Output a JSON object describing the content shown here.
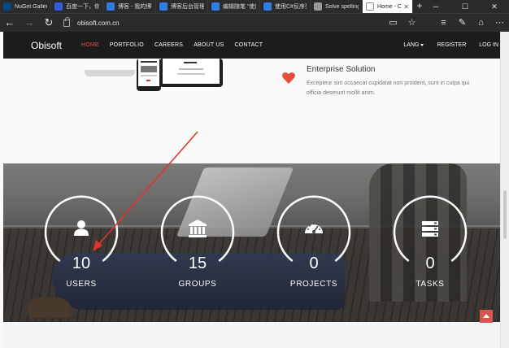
{
  "browser": {
    "tabs": [
      {
        "title": "NuGet Gallery",
        "color": "#004880"
      },
      {
        "title": "百度一下，你就",
        "color": "#2f5ee0"
      },
      {
        "title": "博客 - 我的博客",
        "color": "#2f7de1"
      },
      {
        "title": "博客后台管理",
        "color": "#2f7de1"
      },
      {
        "title": "编辑随笔 \"使用",
        "color": "#2f7de1"
      },
      {
        "title": "使用C#反序列",
        "color": "#2f7de1"
      },
      {
        "title": "Solve spelling",
        "color": "#999999"
      },
      {
        "title": "Home - Ob",
        "color": "#666666",
        "active": true
      }
    ],
    "new_tab": "+",
    "url": "obisoft.com.cn"
  },
  "site": {
    "logo": "Obisoft",
    "menu": [
      "HOME",
      "PORTFOLIO",
      "CAREERS",
      "ABOUT US",
      "CONTACT"
    ],
    "right_menu": {
      "lang": "LANG",
      "register": "REGISTER",
      "login": "LOG IN"
    },
    "accent": "#e74c3c"
  },
  "feature": {
    "title": "Enterprise Solution",
    "description": "Excepteur sint occaecat cupidatat non proident, sunt in culpa qui officia deserunt mollit anim.",
    "icon": "heart-icon"
  },
  "stats": [
    {
      "value": "10",
      "label": "USERS",
      "icon": "user-icon"
    },
    {
      "value": "15",
      "label": "GROUPS",
      "icon": "bank-icon"
    },
    {
      "value": "0",
      "label": "PROJECTS",
      "icon": "dashboard-icon"
    },
    {
      "value": "0",
      "label": "TASKS",
      "icon": "server-icon"
    }
  ]
}
